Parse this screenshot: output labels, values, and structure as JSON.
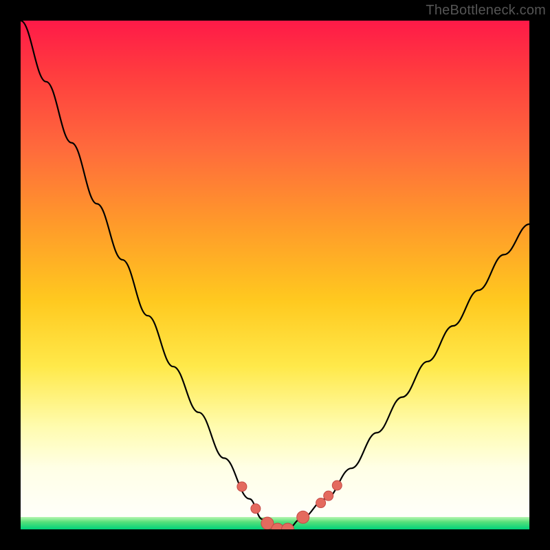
{
  "watermark_text": "TheBottleneck.com",
  "chart_data": {
    "type": "line",
    "title": "",
    "xlabel": "",
    "ylabel": "",
    "x": [
      0.0,
      0.05,
      0.1,
      0.15,
      0.2,
      0.25,
      0.3,
      0.35,
      0.4,
      0.45,
      0.475,
      0.5,
      0.525,
      0.55,
      0.6,
      0.65,
      0.7,
      0.75,
      0.8,
      0.85,
      0.9,
      0.95,
      1.0
    ],
    "values": [
      100,
      88,
      76,
      64,
      53,
      42,
      32,
      23,
      14,
      6,
      2,
      0,
      0,
      2,
      6,
      12,
      19,
      26,
      33,
      40,
      47,
      54,
      60
    ],
    "xlim": [
      0.0,
      1.0
    ],
    "ylim": [
      0,
      100
    ],
    "minimum_x": 0.525,
    "dot_xs": [
      0.435,
      0.462,
      0.485,
      0.505,
      0.525,
      0.555,
      0.59,
      0.605,
      0.622
    ],
    "colors": {
      "curve": "#000000",
      "dots_fill": "#e46a5e",
      "dots_stroke": "#c44a46",
      "gradient_top": "#ff1a48",
      "gradient_mid": "#ffe94a",
      "gradient_bottom_strip": "#00d27a"
    }
  }
}
